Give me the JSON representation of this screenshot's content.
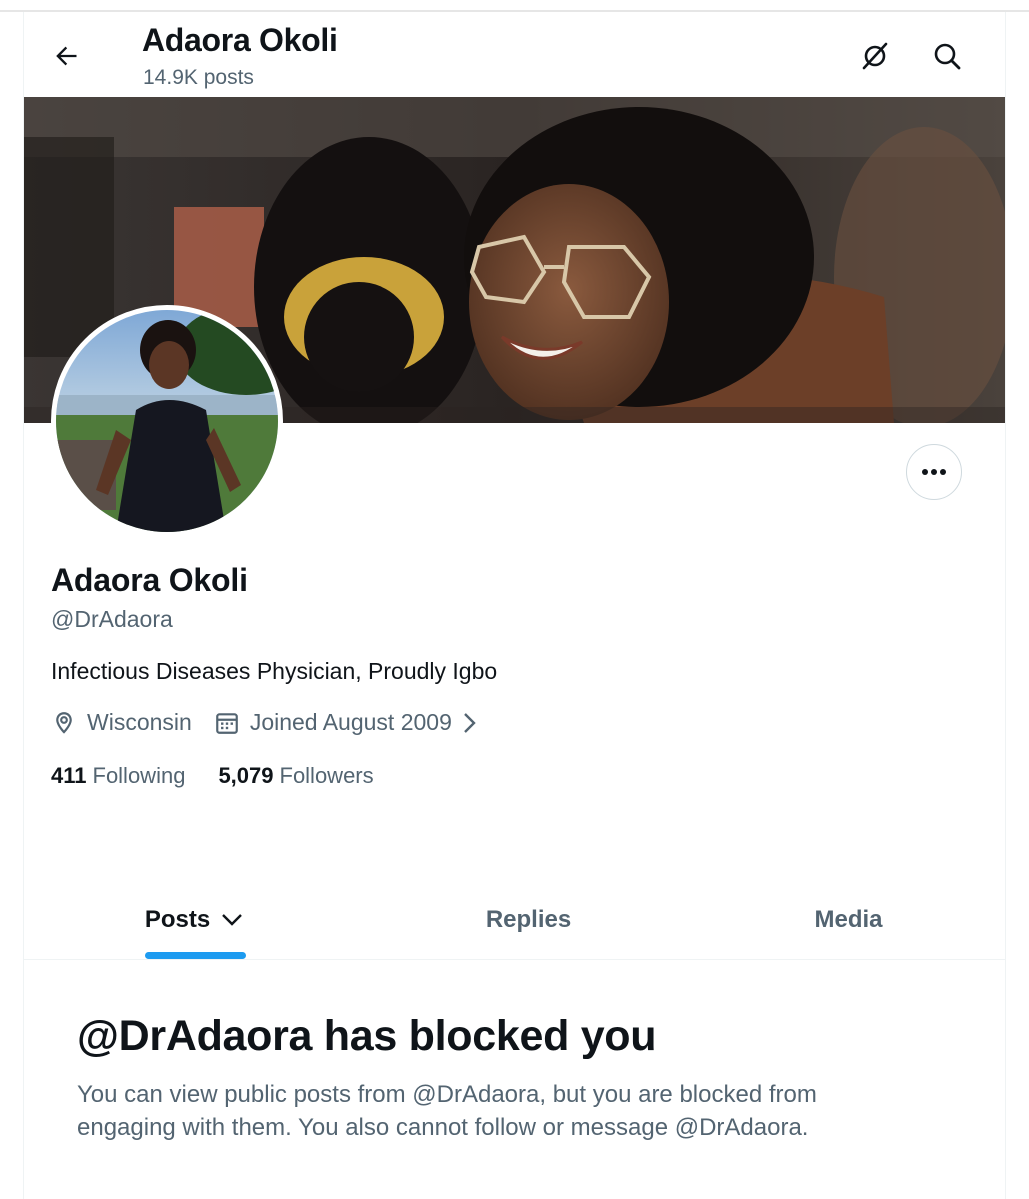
{
  "header": {
    "name": "Adaora Okoli",
    "posts_count": "14.9K posts"
  },
  "profile": {
    "display_name": "Adaora Okoli",
    "handle": "@DrAdaora",
    "bio": "Infectious Diseases Physician, Proudly Igbo",
    "location": "Wisconsin",
    "joined": "Joined August 2009",
    "following_count": "411",
    "following_label": "Following",
    "followers_count": "5,079",
    "followers_label": "Followers"
  },
  "tabs": [
    {
      "label": "Posts",
      "active": true
    },
    {
      "label": "Replies",
      "active": false
    },
    {
      "label": "Media",
      "active": false
    }
  ],
  "blocked": {
    "title": "@DrAdaora has blocked you",
    "message": "You can view public posts from @DrAdaora, but you are blocked from engaging with them. You also cannot follow or message @DrAdaora."
  },
  "icons": {
    "back": "arrow-left-icon",
    "grok": "grok-icon",
    "search": "search-icon",
    "more": "more-horizontal-icon",
    "location": "location-pin-icon",
    "calendar": "calendar-icon"
  },
  "colors": {
    "accent": "#1d9bf0",
    "text_primary": "#0f1419",
    "text_secondary": "#536471",
    "border": "#eff3f4"
  }
}
